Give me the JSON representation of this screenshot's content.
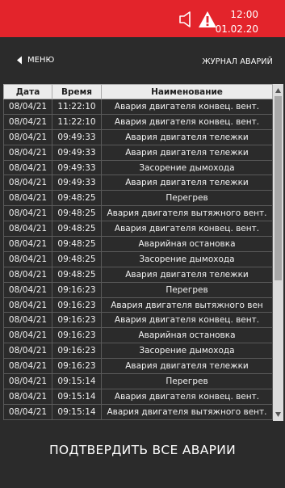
{
  "header": {
    "time": "12:00",
    "date": "01.02.20",
    "icons": {
      "speaker": "speaker-icon",
      "warning": "warning-icon"
    },
    "background": "#e3242b"
  },
  "nav": {
    "back_label": "МЕНЮ",
    "journal_label": "ЖУРНАЛ АВАРИЙ"
  },
  "table": {
    "columns": [
      "Дата",
      "Время",
      "Наименование"
    ],
    "rows": [
      [
        "08/04/21",
        "11:22:10",
        "Авария двигателя конвец. вент."
      ],
      [
        "08/04/21",
        "11:22:10",
        "Авария двигателя конвец. вент."
      ],
      [
        "08/04/21",
        "09:49:33",
        "Авария двигателя тележки"
      ],
      [
        "08/04/21",
        "09:49:33",
        "Авария двигателя тележки"
      ],
      [
        "08/04/21",
        "09:49:33",
        "Засорение дымохода"
      ],
      [
        "08/04/21",
        "09:49:33",
        "Авария двигателя тележки"
      ],
      [
        "08/04/21",
        "09:48:25",
        "Перегрев"
      ],
      [
        "08/04/21",
        "09:48:25",
        "Авария двигателя вытяжного вент."
      ],
      [
        "08/04/21",
        "09:48:25",
        "Авария двигателя конвец. вент."
      ],
      [
        "08/04/21",
        "09:48:25",
        "Аварийная остановка"
      ],
      [
        "08/04/21",
        "09:48:25",
        "Засорение дымохода"
      ],
      [
        "08/04/21",
        "09:48:25",
        "Авария двигателя тележки"
      ],
      [
        "08/04/21",
        "09:16:23",
        "Перегрев"
      ],
      [
        "08/04/21",
        "09:16:23",
        "Авария двигателя вытяжного вен"
      ],
      [
        "08/04/21",
        "09:16:23",
        "Авария двигателя конвец. вент."
      ],
      [
        "08/04/21",
        "09:16:23",
        "Аварийная остановка"
      ],
      [
        "08/04/21",
        "09:16:23",
        "Засорение дымохода"
      ],
      [
        "08/04/21",
        "09:16:23",
        "Авария двигателя тележки"
      ],
      [
        "08/04/21",
        "09:15:14",
        "Перегрев"
      ],
      [
        "08/04/21",
        "09:15:14",
        "Авария двигателя конвец. вент."
      ],
      [
        "08/04/21",
        "09:15:14",
        "Авария двигателя вытяжного вент."
      ]
    ]
  },
  "footer": {
    "confirm_label": "ПОДТВЕРДИТЬ ВСЕ АВАРИИ"
  }
}
